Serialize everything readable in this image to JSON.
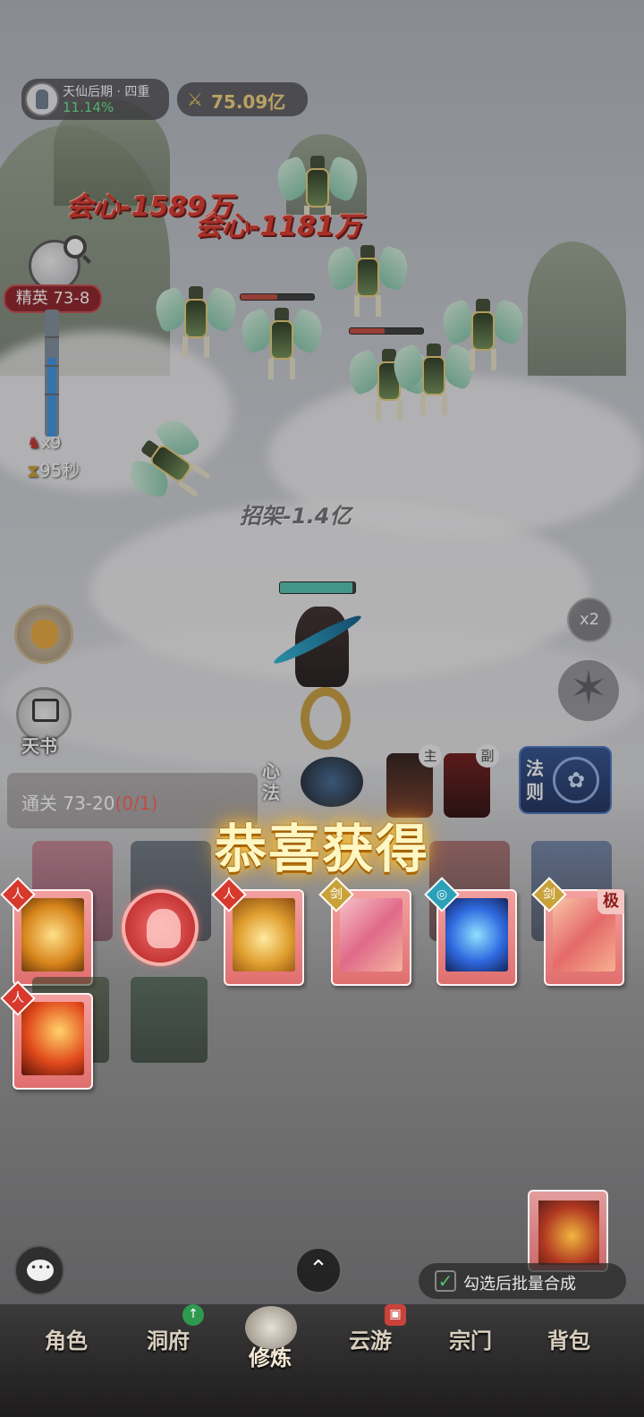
{
  "hud": {
    "realm_name": "天仙后期 · 四重",
    "realm_progress": "11.14%",
    "power_value": "75.09亿"
  },
  "battle": {
    "crit_text_1": "会心-1589万",
    "crit_text_2": "会心-1181万",
    "parry_text": "招架-1.4亿"
  },
  "stage": {
    "badge": "精英 73-8",
    "kill_count": "x9",
    "timer": "95秒",
    "progress_fraction": 0.62
  },
  "side_buttons": {
    "tianshu_label": "天书",
    "speed_label": "x2"
  },
  "skills": {
    "xinfa_label": "心法",
    "main_tag": "主",
    "sub_tag": "副",
    "law_label": "法则"
  },
  "clear": {
    "label": "通关 73-20",
    "count": "(0/1)"
  },
  "reward": {
    "title": "恭喜获得",
    "rank_label": "极",
    "emblem_person": "人",
    "emblem_sword": "剑",
    "emblem_swirl": "◎"
  },
  "controls": {
    "expand_icon": "⌃",
    "batch_label": "勾选后批量合成",
    "check_mark": "✓"
  },
  "nav": {
    "items": [
      "角色",
      "洞府",
      "修炼",
      "云游",
      "宗门",
      "背包"
    ],
    "active": "修炼"
  },
  "colors": {
    "accent_gold": "#f2d27a",
    "progress_green": "#69e38b",
    "card_pink": "#e06f6f",
    "crit_red": "#d8352c"
  }
}
